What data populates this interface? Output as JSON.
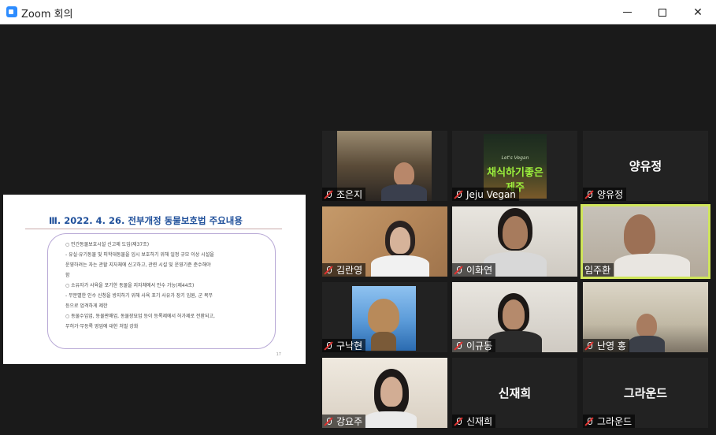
{
  "window": {
    "title": "Zoom 회의",
    "controls": {
      "minimize": "minimize",
      "maximize": "maximize",
      "close": "✕"
    }
  },
  "shared_content": {
    "title": "Ⅲ. 2022. 4. 26. 전부개정 동물보호법 주요내용",
    "lines": [
      "○ 민간동물보호시설 신고제 도입(제37조)",
      "- 유실·유기동물 및 피학대동물을 임시 보호하기 위해 일정 규모 이상 시설을",
      "운영하려는 자는 관할 지자체에 신고하고, 관련 시설 및 운영기준 준수해야",
      "함",
      "○ 소유자가 사육을 포기한 동물을 지자체에서 인수 가능(제44조)",
      "- 무분별한 인수 신청을 방지하기 위해 사육 포기 사유가 장기 입원, 군 복무",
      "등으로 엄격하게 제한",
      "○ 동물수입업, 동물판매업, 동물장묘업 등이 등록제에서 허가제로 전환되고,",
      "무허가·무등록 영업에 대한 처벌 강화"
    ],
    "page_number": "17"
  },
  "participants": [
    {
      "name": "조은지",
      "video": true,
      "scene": "room"
    },
    {
      "name": "Jeju Vegan",
      "video": true,
      "scene": "vegan",
      "overlay_small": "Let's Vegan",
      "overlay_text": "채식하기좋은제주"
    },
    {
      "name": "양유정",
      "video": false
    },
    {
      "name": "김란영",
      "video": true,
      "scene": "wood"
    },
    {
      "name": "이화연",
      "video": true,
      "scene": "white"
    },
    {
      "name": "임주환",
      "video": true,
      "scene": "warm",
      "active_speaker": true
    },
    {
      "name": "구낙현",
      "video": true,
      "scene": "sea"
    },
    {
      "name": "이규동",
      "video": true,
      "scene": "white"
    },
    {
      "name": "난영 홍",
      "video": true,
      "scene": "office"
    },
    {
      "name": "강요주",
      "video": true,
      "scene": "living"
    },
    {
      "name": "신재희",
      "video": false
    },
    {
      "name": "그라운드",
      "video": false
    }
  ],
  "icons": {
    "muted": "mic-muted-icon",
    "app": "zoom-icon"
  },
  "colors": {
    "active_border": "#cfe55a",
    "muted": "#e0312f",
    "background": "#1a1a1a"
  }
}
